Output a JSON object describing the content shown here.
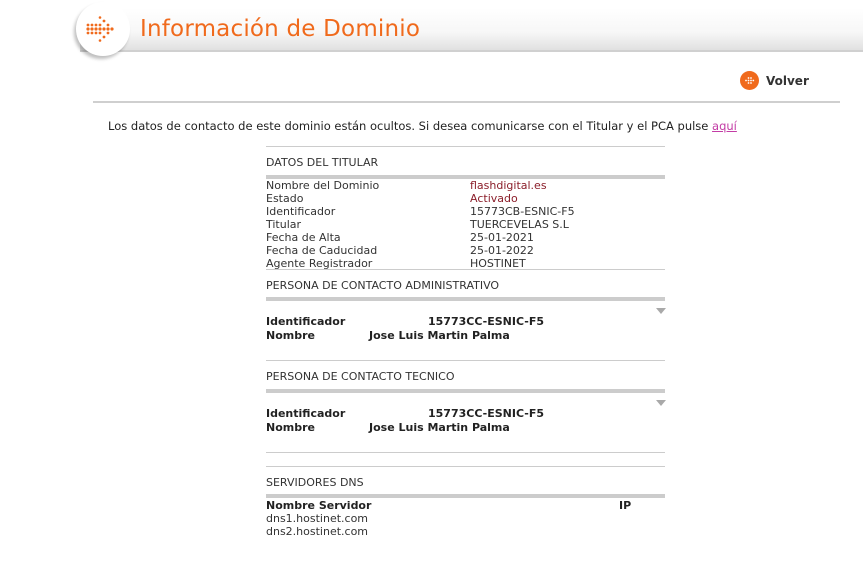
{
  "header": {
    "title": "Información de Dominio"
  },
  "nav": {
    "back_label": "Volver"
  },
  "notice": {
    "text": "Los datos de contacto de este dominio están ocultos. Si desea comunicarse con el Titular y el PCA pulse ",
    "link_label": "aquí"
  },
  "titular": {
    "title": "DATOS DEL TITULAR",
    "rows": [
      {
        "label": "Nombre del Dominio",
        "value": "flashdigital.es"
      },
      {
        "label": "Estado",
        "value": "Activado"
      },
      {
        "label": "Identificador",
        "value": "15773CB-ESNIC-F5"
      },
      {
        "label": "Titular",
        "value": "TUERCEVELAS S.L"
      },
      {
        "label": "Fecha de Alta",
        "value": "25-01-2021"
      },
      {
        "label": "Fecha de Caducidad",
        "value": "25-01-2022"
      },
      {
        "label": "Agente Registrador",
        "value": "HOSTINET"
      }
    ]
  },
  "admin": {
    "title": "PERSONA DE CONTACTO ADMINISTRATIVO",
    "id_label": "Identificador",
    "id_value": "15773CC-ESNIC-F5",
    "name_label": "Nombre",
    "name_value": "Jose Luis Martin Palma"
  },
  "tech": {
    "title": "PERSONA DE CONTACTO TECNICO",
    "id_label": "Identificador",
    "id_value": "15773CC-ESNIC-F5",
    "name_label": "Nombre",
    "name_value": "Jose Luis Martin Palma"
  },
  "dns": {
    "title": "SERVIDORES DNS",
    "col_server": "Nombre Servidor",
    "col_ip": "IP",
    "servers": [
      "dns1.hostinet.com",
      "dns2.hostinet.com"
    ]
  },
  "colors": {
    "accent": "#f06a1c",
    "link": "#c33ca5",
    "value_red": "#8b1e2a"
  }
}
